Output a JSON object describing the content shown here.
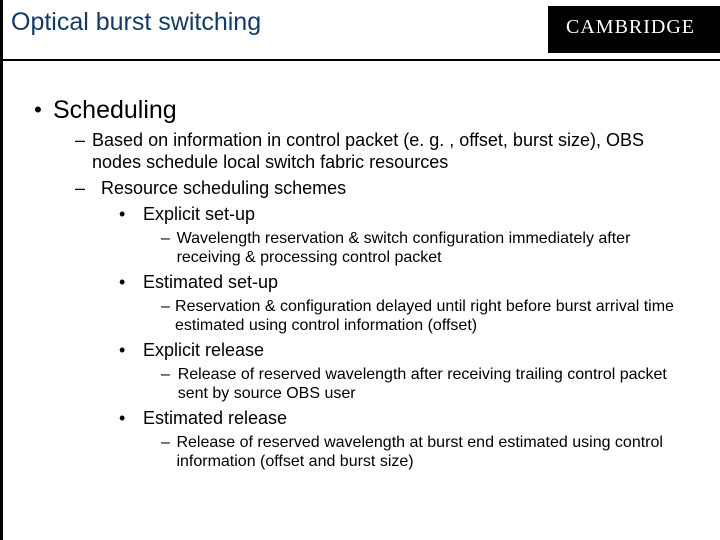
{
  "brand": "CAMBRIDGE",
  "title": "Optical burst switching",
  "heading": "Scheduling",
  "pt1": "Based on information in control packet (e. g. , offset, burst size), OBS nodes schedule local switch fabric resources",
  "pt2": "Resource scheduling schemes",
  "sub1": "Explicit set-up",
  "sub1d": "Wavelength reservation & switch configuration immediately after receiving & processing control packet",
  "sub2": "Estimated set-up",
  "sub2d": "Reservation & configuration delayed until right before burst arrival time estimated using control information (offset)",
  "sub3": "Explicit release",
  "sub3d": "Release of reserved wavelength after receiving trailing control packet sent by source OBS user",
  "sub4": "Estimated release",
  "sub4d": "Release of reserved wavelength at burst end estimated using control information (offset and burst size)"
}
